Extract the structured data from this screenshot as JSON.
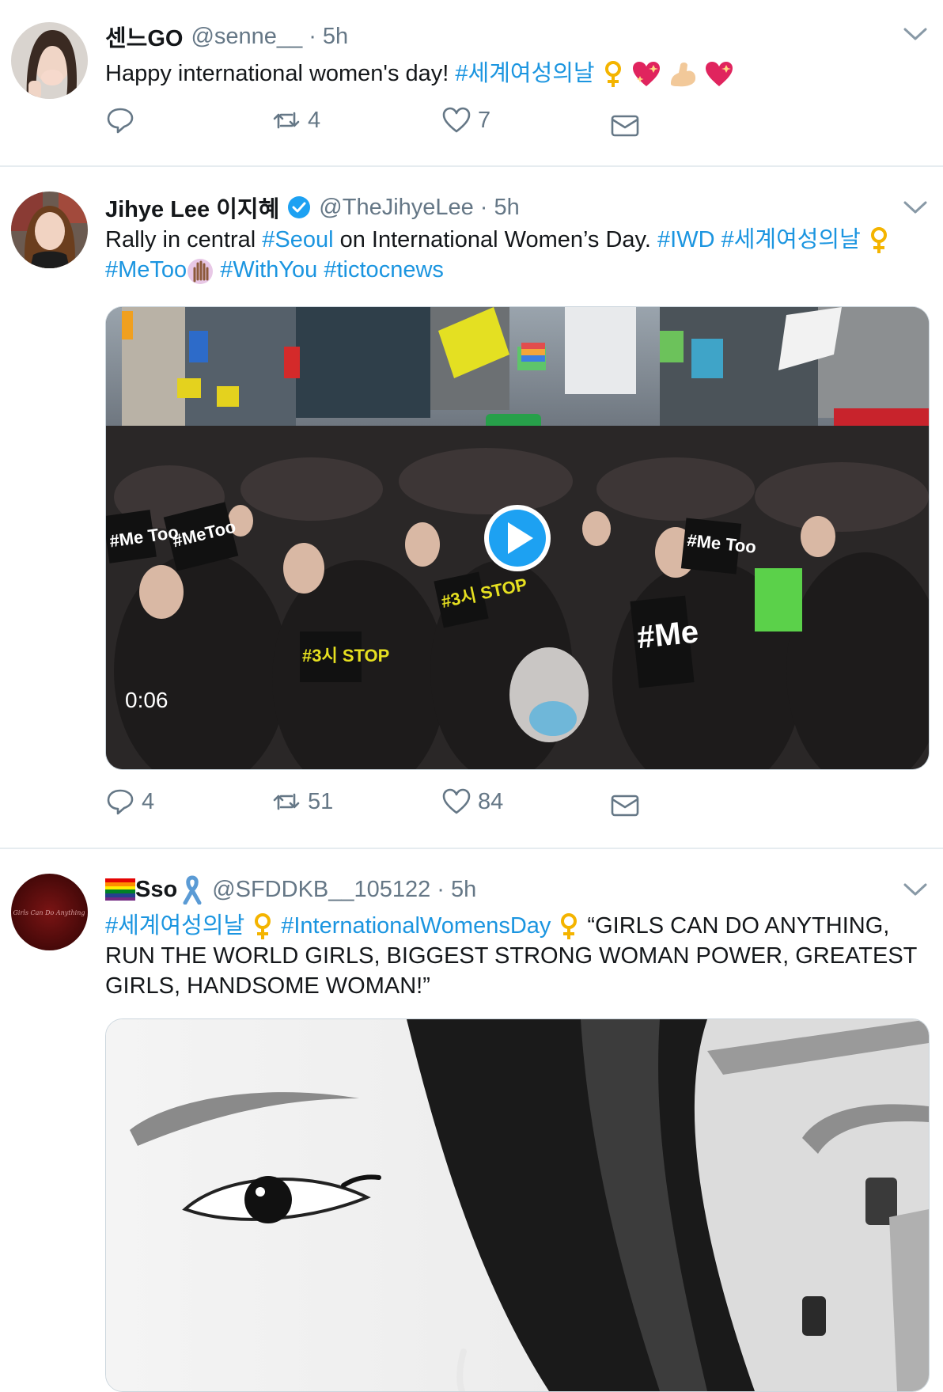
{
  "tweets": [
    {
      "display_name": "센느GO",
      "handle": "@senne__",
      "separator": "·",
      "time": "5h",
      "text_plain": "Happy international women's day! ",
      "hashtag1": "#세계여성의날",
      "actions": {
        "reply_count": "",
        "retweet_count": "4",
        "like_count": "7"
      }
    },
    {
      "display_name": "Jihye Lee 이지혜",
      "verified": true,
      "handle": "@TheJihyeLee",
      "separator": "·",
      "time": "5h",
      "text_part1": "Rally in central ",
      "tag_seoul": "#Seoul",
      "text_part2": " on International Women’s Day. ",
      "tag_iwd": "#IWD",
      "tag_korean": "#세계여성의날",
      "tag_metoo": "#MeToo",
      "tag_withyou": "#WithYou",
      "tag_tictoc": "#tictocnews",
      "video": {
        "duration": "0:06",
        "signs": [
          "#Me Too",
          "#3시 STOP",
          "#MeToo",
          "#Me Too",
          "#3시 STOP",
          "#Me"
        ]
      },
      "actions": {
        "reply_count": "4",
        "retweet_count": "51",
        "like_count": "84"
      }
    },
    {
      "display_name": "Sso",
      "handle": "@SFDDKB__105122",
      "separator": "·",
      "time": "5h",
      "tag_korean": "#세계여성의날",
      "tag_iwd": "#InternationalWomensDay",
      "text": "“GIRLS CAN DO ANYTHING, RUN THE WORLD GIRLS, BIGGEST STRONG WOMAN POWER, GREATEST GIRLS, HANDSOME WOMAN!”",
      "avatar_text": "Girls Can Do Anything"
    }
  ],
  "icons": {
    "reply": "speech-bubble-icon",
    "retweet": "retweet-arrows-icon",
    "like": "heart-icon",
    "dm": "envelope-icon",
    "caret": "chevron-down-icon",
    "venus": "female-sign-emoji",
    "play": "play-icon"
  },
  "colors": {
    "link": "#1b95e0",
    "secondary": "#657786",
    "divider": "#e6ecf0",
    "verified": "#1da1f2",
    "play": "#1da1f2"
  }
}
